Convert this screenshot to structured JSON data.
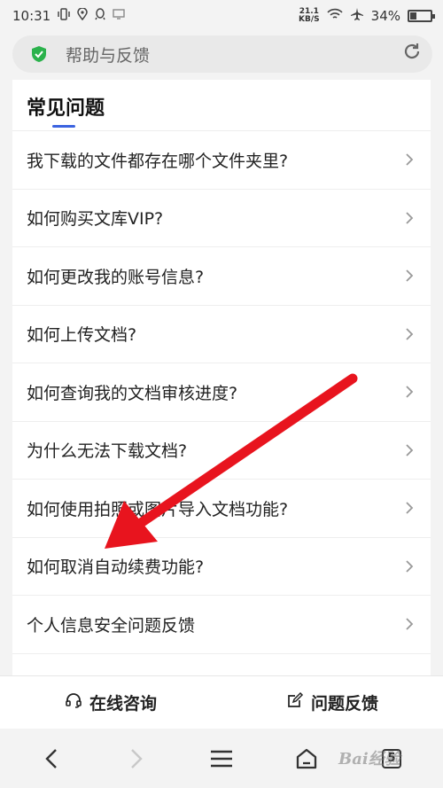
{
  "status_bar": {
    "time": "10:31",
    "speed_value": "21.1",
    "speed_unit": "KB/S",
    "battery": "34%",
    "battery_level": 0.34
  },
  "address_bar": {
    "title": "帮助与反馈"
  },
  "section": {
    "title": "常见问题"
  },
  "faq": [
    {
      "label": "我下载的文件都存在哪个文件夹里?"
    },
    {
      "label": "如何购买文库VIP?"
    },
    {
      "label": "如何更改我的账号信息?"
    },
    {
      "label": "如何上传文档?"
    },
    {
      "label": "如何查询我的文档审核进度?"
    },
    {
      "label": "为什么无法下载文档?"
    },
    {
      "label": "如何使用拍照或图片导入文档功能?"
    },
    {
      "label": "如何取消自动续费功能?"
    },
    {
      "label": "个人信息安全问题反馈"
    }
  ],
  "actions": {
    "online_consult": "在线咨询",
    "feedback": "问题反馈"
  },
  "browser_nav": {
    "tab_count": "5"
  },
  "watermark": "Bai经验",
  "colors": {
    "accent": "#3b63e0",
    "secure": "#2bb24c",
    "arrow": "#e8141e"
  }
}
